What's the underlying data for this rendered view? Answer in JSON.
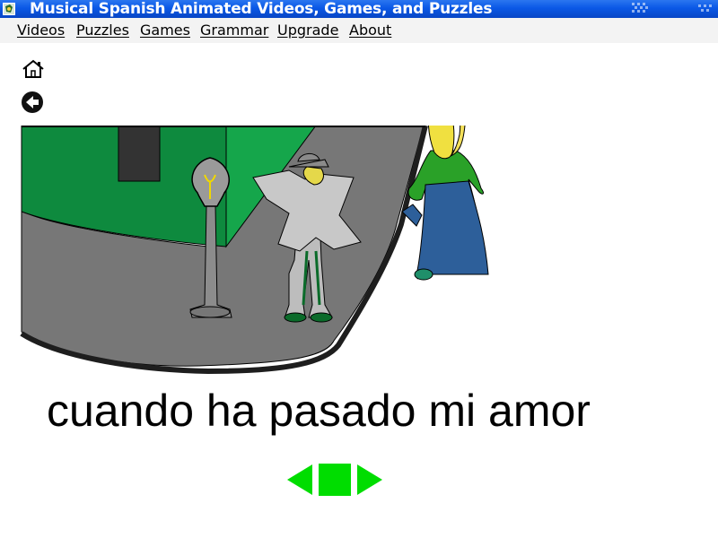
{
  "window": {
    "title": "Musical Spanish Animated Videos, Games, and Puzzles"
  },
  "menu": {
    "items": [
      {
        "label": "Videos"
      },
      {
        "label": "Puzzles"
      },
      {
        "label": "Games"
      },
      {
        "label": "Grammar"
      },
      {
        "label": "Upgrade"
      },
      {
        "label": "About"
      }
    ]
  },
  "toolbar": {
    "home_icon": "home-icon",
    "back_icon": "back-arrow-icon"
  },
  "scene": {
    "illustration": "street-scene"
  },
  "lyric": {
    "text": "cuando ha pasado mi amor"
  },
  "controls": {
    "prev_icon": "previous-triangle-icon",
    "stop_icon": "stop-square-icon",
    "next_icon": "next-triangle-icon",
    "color": "#00dd00"
  },
  "colors": {
    "titlebar": "#0a58e6",
    "menubar": "#f3f3f3",
    "building_green": "#0e8a3e",
    "street_gray": "#777777"
  }
}
